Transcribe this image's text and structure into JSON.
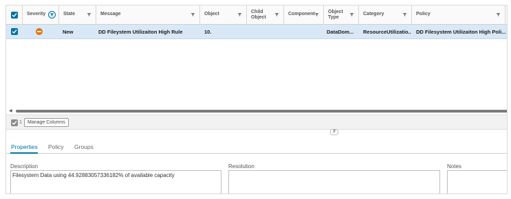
{
  "grid": {
    "columns": [
      {
        "label": "Severity"
      },
      {
        "label": "State"
      },
      {
        "label": "Message"
      },
      {
        "label": "Object"
      },
      {
        "label": "Child Object"
      },
      {
        "label": "Component"
      },
      {
        "label": "Object Type"
      },
      {
        "label": "Category"
      },
      {
        "label": "Policy"
      }
    ],
    "rows": [
      {
        "severity": "minor",
        "state": "New",
        "message": "DD Fileystem Utilizaiton High Rule",
        "object": "10.",
        "child_object": "",
        "component": "",
        "object_type": "DataDom...",
        "category": "ResourceUtilizatio...",
        "policy": "DD Filesystem Utilizaiton High Poli..."
      }
    ],
    "selected_count": "1",
    "manage_columns_label": "Manage Columns",
    "splitter_glyph": "⇵",
    "scroll_left_glyph": "◀"
  },
  "detail": {
    "tabs": [
      {
        "label": "Properties",
        "active": true
      },
      {
        "label": "Policy"
      },
      {
        "label": "Groups"
      }
    ],
    "description_label": "Description",
    "description_value": "Filesystem Data using 44.92883057336182% of available capacity",
    "resolution_label": "Resolution",
    "resolution_value": "",
    "notes_label": "Notes",
    "notes_value": ""
  },
  "colors": {
    "accent": "#0072a3",
    "severity_minor": "#e57200",
    "selected_row": "#d8e8f6"
  },
  "icons": {
    "header_checkbox": "checkbox-checked-icon",
    "severity_filter": "filter-active-icon",
    "column_filter": "filter-icon",
    "severity": "minor-severity-icon",
    "splitter": "resize-handle-icon"
  }
}
